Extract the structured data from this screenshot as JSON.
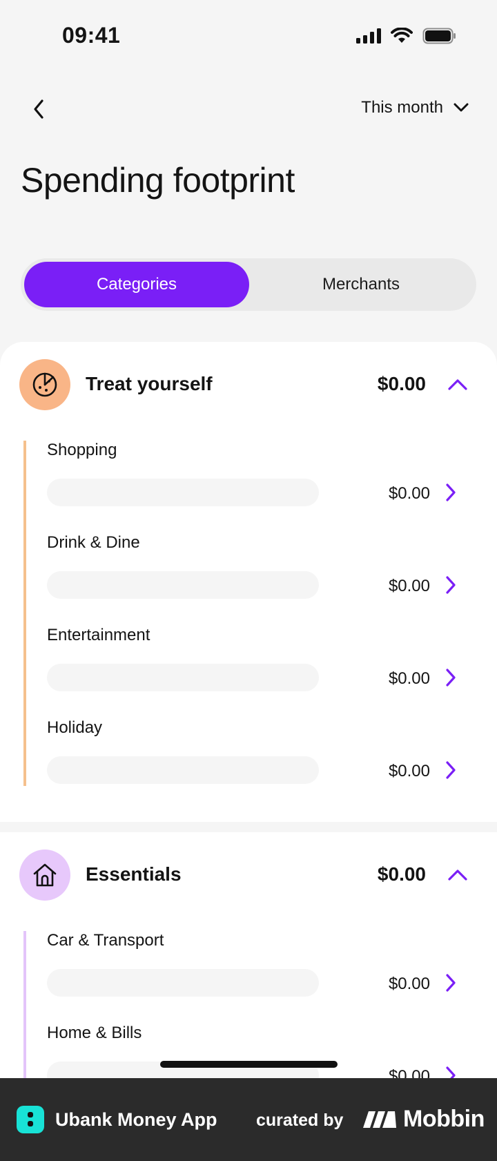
{
  "status_bar": {
    "time": "09:41"
  },
  "nav": {
    "period_label": "This month"
  },
  "page": {
    "title": "Spending footprint"
  },
  "tabs": [
    {
      "label": "Categories",
      "active": true
    },
    {
      "label": "Merchants",
      "active": false
    }
  ],
  "colors": {
    "accent": "#7a1ff6",
    "treat_bg": "#f9b587",
    "treat_line": "#f5c08d",
    "essentials_bg": "#e7c8fb",
    "essentials_line": "#e3c4fa"
  },
  "groups": [
    {
      "title": "Treat yourself",
      "amount": "$0.00",
      "icon": "pizza-icon",
      "categories": [
        {
          "name": "Shopping",
          "amount": "$0.00",
          "fill": 0
        },
        {
          "name": "Drink & Dine",
          "amount": "$0.00",
          "fill": 0
        },
        {
          "name": "Entertainment",
          "amount": "$0.00",
          "fill": 0
        },
        {
          "name": "Holiday",
          "amount": "$0.00",
          "fill": 0
        }
      ]
    },
    {
      "title": "Essentials",
      "amount": "$0.00",
      "icon": "house-icon",
      "categories": [
        {
          "name": "Car & Transport",
          "amount": "$0.00",
          "fill": 0
        },
        {
          "name": "Home & Bills",
          "amount": "$0.00",
          "fill": 0
        }
      ]
    }
  ],
  "footer": {
    "app_name": "Ubank Money App",
    "curated_by": "curated by",
    "brand": "Mobbin"
  }
}
